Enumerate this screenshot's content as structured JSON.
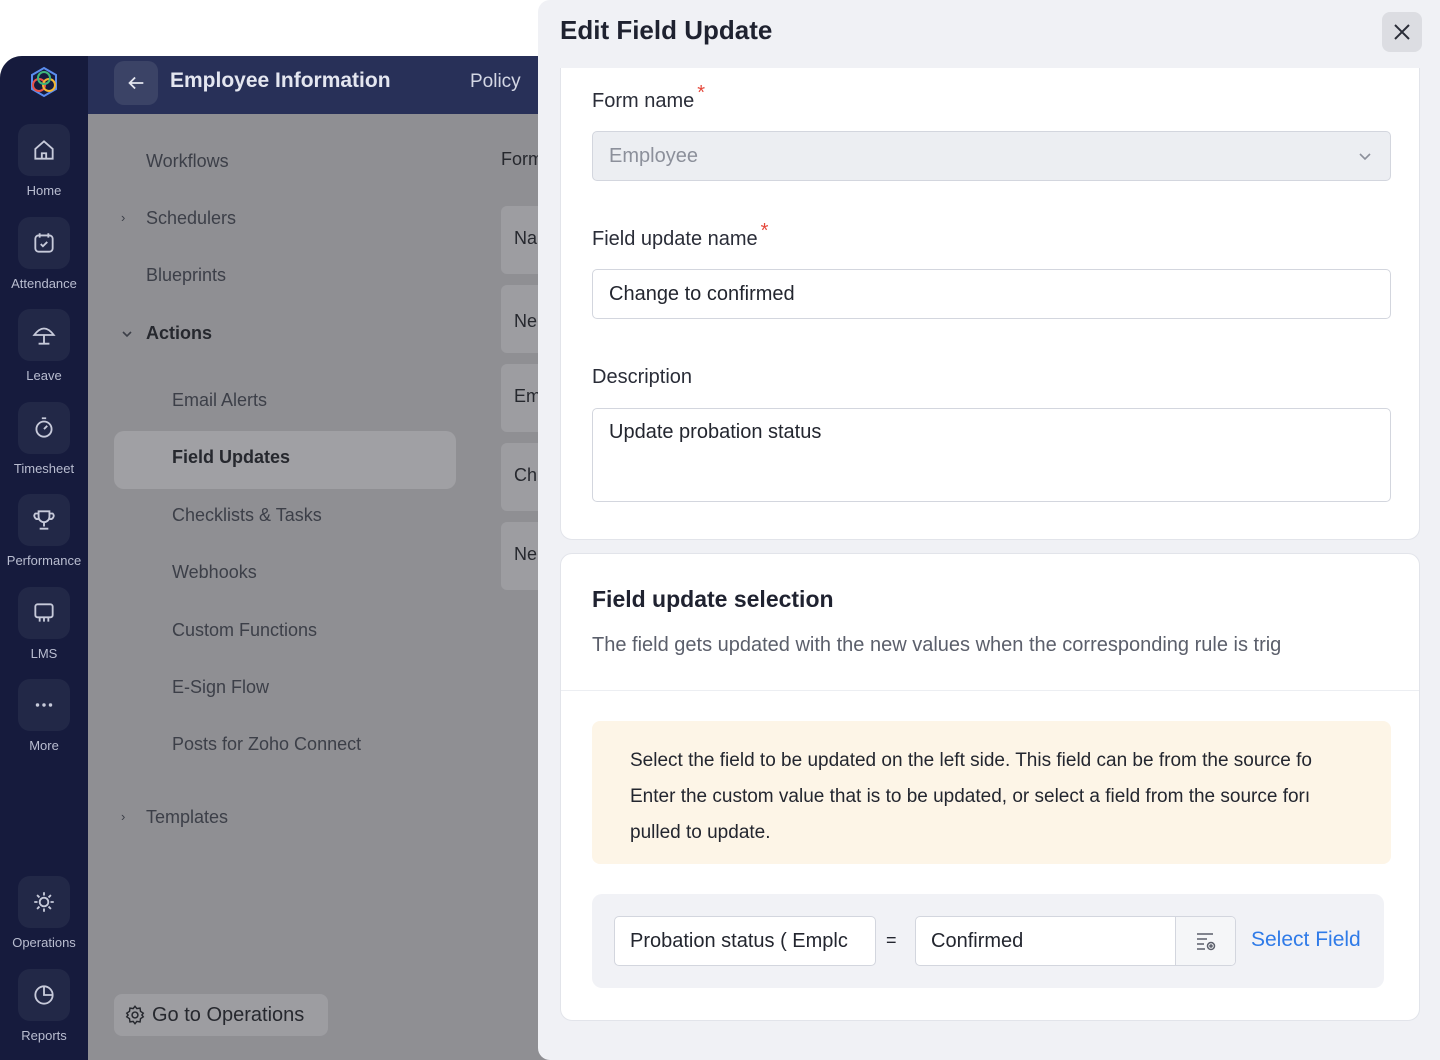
{
  "rail": {
    "items": [
      {
        "label": "Home",
        "icon": "home-icon"
      },
      {
        "label": "Attendance",
        "icon": "calendar-check-icon"
      },
      {
        "label": "Leave",
        "icon": "umbrella-icon"
      },
      {
        "label": "Timesheet",
        "icon": "stopwatch-icon"
      },
      {
        "label": "Performance",
        "icon": "trophy-icon"
      },
      {
        "label": "LMS",
        "icon": "board-icon"
      },
      {
        "label": "More",
        "icon": "more-icon"
      }
    ],
    "bottom": [
      {
        "label": "Operations",
        "icon": "operations-icon"
      },
      {
        "label": "Reports",
        "icon": "pie-chart-icon"
      }
    ]
  },
  "topbar": {
    "title": "Employee Information",
    "tab": "Policy"
  },
  "sidebar": {
    "items": [
      "Workflows",
      "Schedulers",
      "Blueprints",
      "Actions",
      "Email Alerts",
      "Field Updates",
      "Checklists & Tasks",
      "Webhooks",
      "Custom Functions",
      "E-Sign Flow",
      "Posts for Zoho Connect",
      "Templates"
    ],
    "go_ops": "Go to Operations"
  },
  "list": {
    "header": "Form",
    "rows": [
      "Na",
      "Ne",
      "Em",
      "Ch",
      "Ne"
    ]
  },
  "drawer": {
    "title": "Edit Field Update",
    "form_name_label": "Form name",
    "form_name_value": "Employee",
    "field_update_name_label": "Field update name",
    "field_update_name_value": "Change to confirmed",
    "description_label": "Description",
    "description_value": "Update probation status",
    "required_mark": "*",
    "selection": {
      "title": "Field update selection",
      "subtitle": "The field gets updated with the new values when the corresponding rule is trig",
      "info": [
        "Select the field to be updated on the left side. This field can be from the source fo",
        "Enter the custom value that is to be updated, or select a field from the source forı",
        "pulled to update."
      ],
      "left_field": "Probation status ( Emplc",
      "operator": "=",
      "value": "Confirmed",
      "select_field": "Select Field"
    }
  },
  "colors": {
    "accent": "#2f7be8",
    "rail": "#161b3d",
    "topbar": "#283058",
    "required": "#e5483b"
  }
}
